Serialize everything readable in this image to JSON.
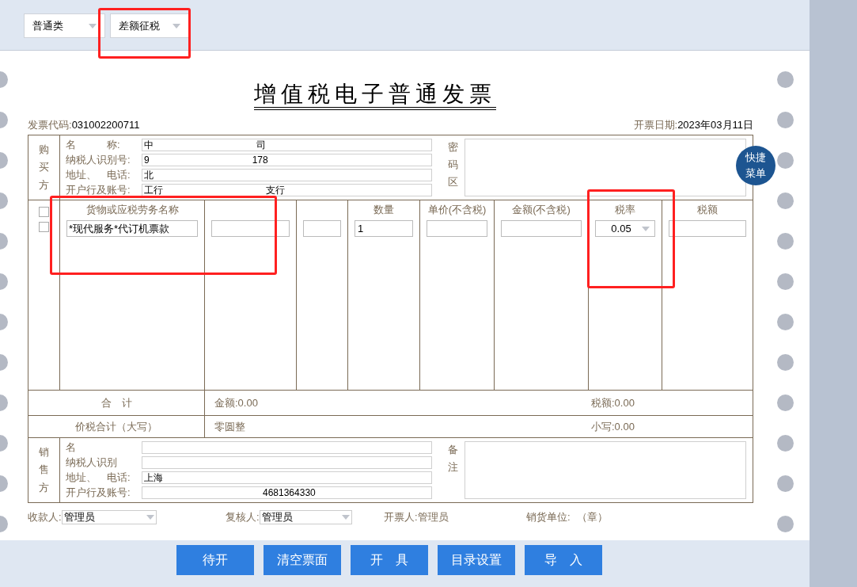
{
  "toolbar": {
    "selects": [
      {
        "value": "普通类"
      },
      {
        "value": "差额征税"
      }
    ]
  },
  "invoice": {
    "title": "增值税电子普通发票",
    "code_label": "发票代码:",
    "code": "031002200711",
    "date_label": "开票日期:",
    "date": "2023年03月11日"
  },
  "buyer": {
    "side_label": "购买方",
    "fields": [
      {
        "label": "名　　　称:",
        "value": "中",
        "tail": "司"
      },
      {
        "label": "纳税人识别号:",
        "value": "9",
        "tail": "178"
      },
      {
        "label": "地址、　电话:",
        "value": "北"
      },
      {
        "label": "开户行及账号:",
        "value": "工行",
        "tail": "支行"
      }
    ],
    "cipher_label": "密码区"
  },
  "quick_menu": "快捷菜单",
  "goods": {
    "headers": {
      "name": "货物或应税劳务名称",
      "quantity": "数量",
      "unit_price": "单价(不含税)",
      "amount": "金额(不含税)",
      "tax_rate": "税率",
      "tax": "税额"
    },
    "rows": [
      {
        "checked": false,
        "name": "*现代服务*代订机票款",
        "quantity": "1",
        "tax_rate": "0.05"
      },
      {
        "checked": false
      }
    ]
  },
  "totals": {
    "label": "合　计",
    "amount": "金额:0.00",
    "tax": "税额:0.00"
  },
  "grand_total": {
    "label": "价税合计（大写）",
    "words": "零圆整",
    "small": "小写:0.00"
  },
  "seller": {
    "side_label": "销售方",
    "fields": [
      {
        "label": "名"
      },
      {
        "label": "纳税人识别"
      },
      {
        "label": "地址、　电话:",
        "value": "上海"
      },
      {
        "label": "开户行及账号:",
        "tail": "4681364330"
      }
    ],
    "remarks_label": "备注"
  },
  "signatures": [
    {
      "kind": "select",
      "label": "收款人:",
      "value": "管理员"
    },
    {
      "kind": "select",
      "label": "复核人:",
      "value": "管理员"
    },
    {
      "kind": "text",
      "label": "开票人:",
      "value": "管理员"
    },
    {
      "kind": "text",
      "label": "销货单位:",
      "value": "（章）"
    }
  ],
  "buttons": [
    "待开",
    "清空票面",
    "开　具",
    "目录设置",
    "导　入"
  ]
}
